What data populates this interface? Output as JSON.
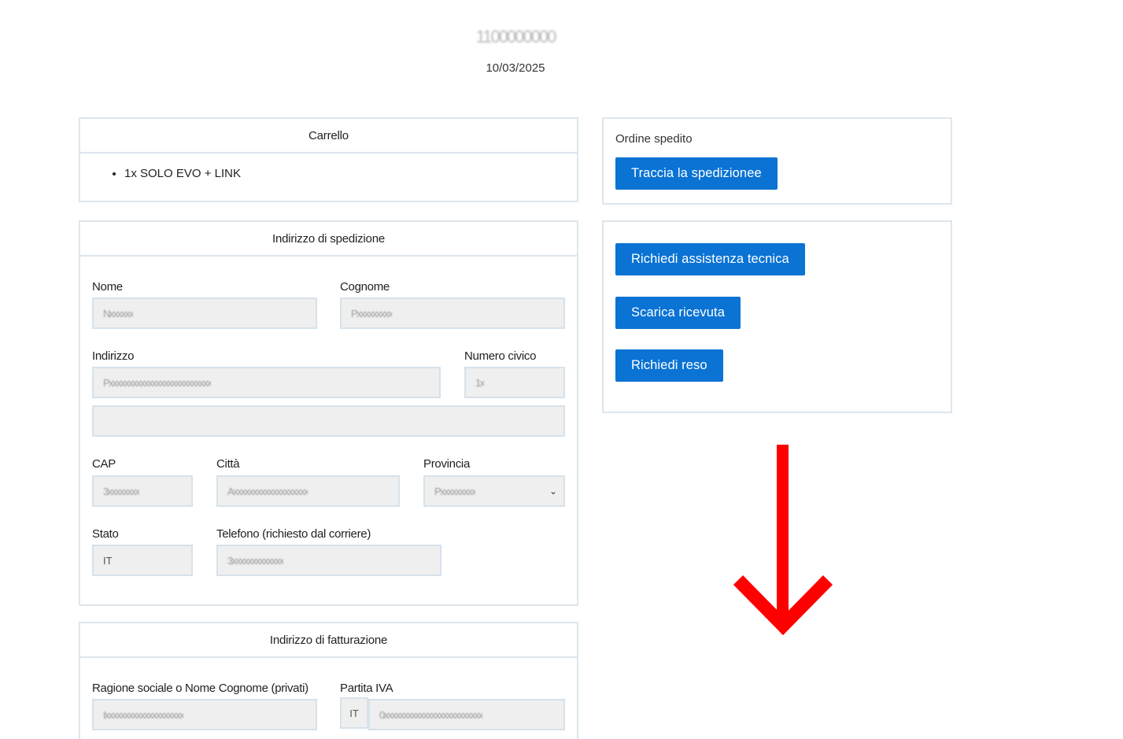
{
  "header": {
    "order_id": "1100000000",
    "date": "10/03/2025"
  },
  "cart": {
    "title": "Carrello",
    "items": [
      "1x SOLO EVO + LINK"
    ]
  },
  "shipping": {
    "title": "Indirizzo di spedizione",
    "nome_label": "Nome",
    "nome_value": "Nxxxxxx",
    "cognome_label": "Cognome",
    "cognome_value": "Pxxxxxxxxx",
    "indirizzo_label": "Indirizzo",
    "indirizzo_value": "Pxxxxxxxxxxxxxxxxxxxxxxxxxx",
    "indirizzo2_value": "",
    "civico_label": "Numero civico",
    "civico_value": "1x",
    "cap_label": "CAP",
    "cap_value": "3xxxxxxxx",
    "citta_label": "Città",
    "citta_value": "Axxxxxxxxxxxxxxxxxxx",
    "provincia_label": "Provincia",
    "provincia_value": "Pxxxxxxxxx",
    "stato_label": "Stato",
    "stato_value": "IT",
    "telefono_label": "Telefono (richiesto dal corriere)",
    "telefono_value": "3xxxxxxxxxxxxx"
  },
  "billing": {
    "title": "Indirizzo di fatturazione",
    "ragione_label": "Ragione sociale o Nome Cognome (privati)",
    "ragione_value": "Ixxxxxxxxxxxxxxxxxxxx",
    "piva_label": "Partita IVA",
    "piva_prefix": "IT",
    "piva_value": "0xxxxxxxxxxxxxxxxxxxxxxxxx"
  },
  "status": {
    "text": "Ordine spedito",
    "track_button": "Traccia la spedizionee"
  },
  "actions": {
    "assistance_button": "Richiedi assistenza tecnica",
    "receipt_button": "Scarica ricevuta",
    "return_button": "Richiedi reso"
  },
  "colors": {
    "button": "#0a73d4",
    "arrow": "#ff0000",
    "panel_border": "#dde6ee",
    "field_bg": "#efefef"
  },
  "icons": {
    "select_chevron": "chevron-down-icon",
    "annotation_arrow": "arrow-down-icon"
  }
}
